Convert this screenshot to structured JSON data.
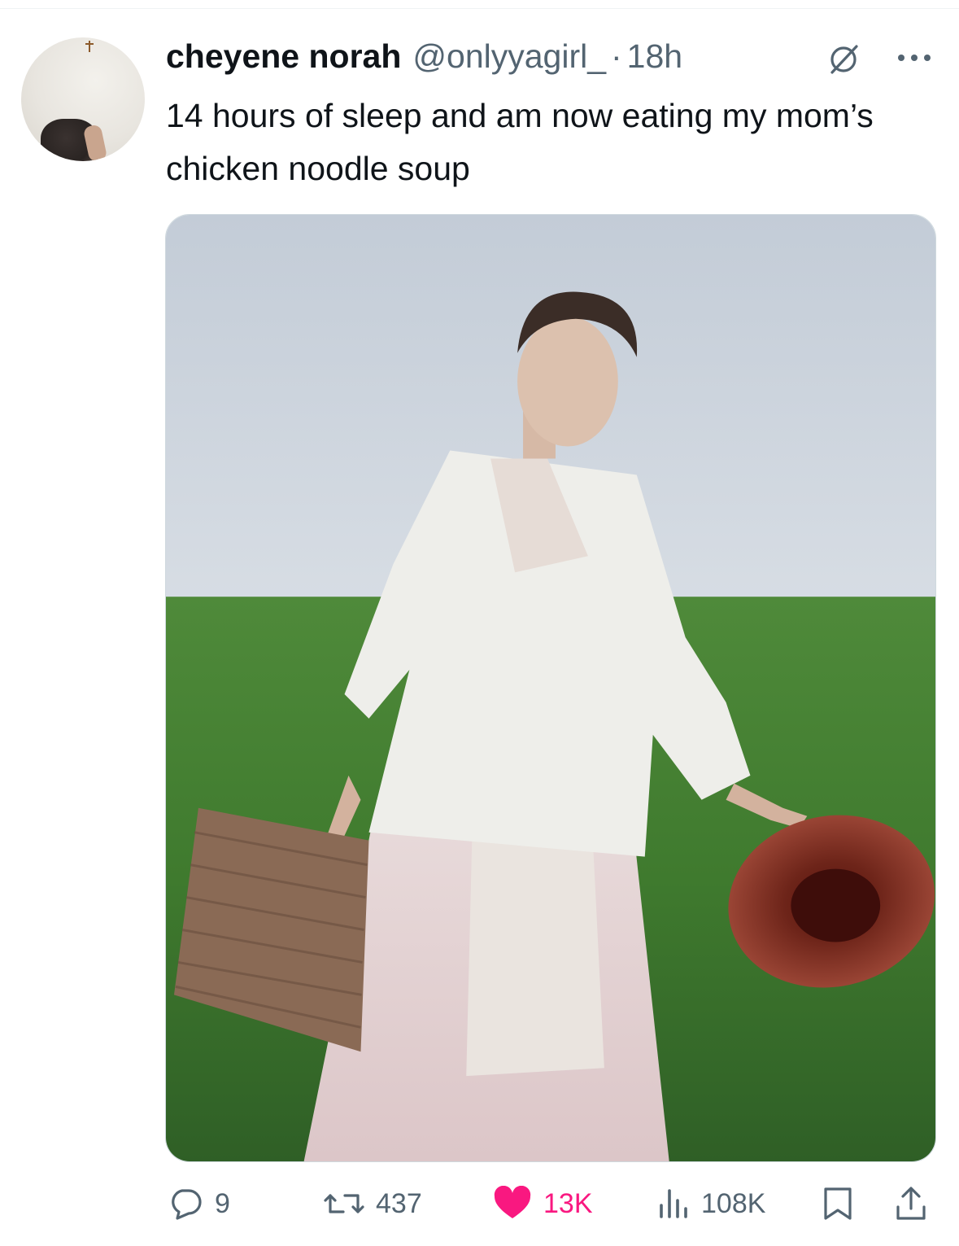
{
  "tweet": {
    "display_name": "cheyene norah",
    "handle": "@onlyyagirl_",
    "separator": "·",
    "time": "18h",
    "text": "14 hours of sleep and am now eating my mom’s chicken noodle soup"
  },
  "metrics": {
    "replies": "9",
    "reposts": "437",
    "likes": "13K",
    "views": "108K"
  },
  "colors": {
    "text_primary": "#0f1419",
    "text_secondary": "#536471",
    "like_active": "#f91880",
    "border": "#cfd9de"
  },
  "icons": {
    "grok": "grok-icon",
    "more": "more-icon",
    "reply": "reply-icon",
    "repost": "repost-icon",
    "like": "heart-icon",
    "views": "views-icon",
    "bookmark": "bookmark-icon",
    "share": "share-icon"
  }
}
